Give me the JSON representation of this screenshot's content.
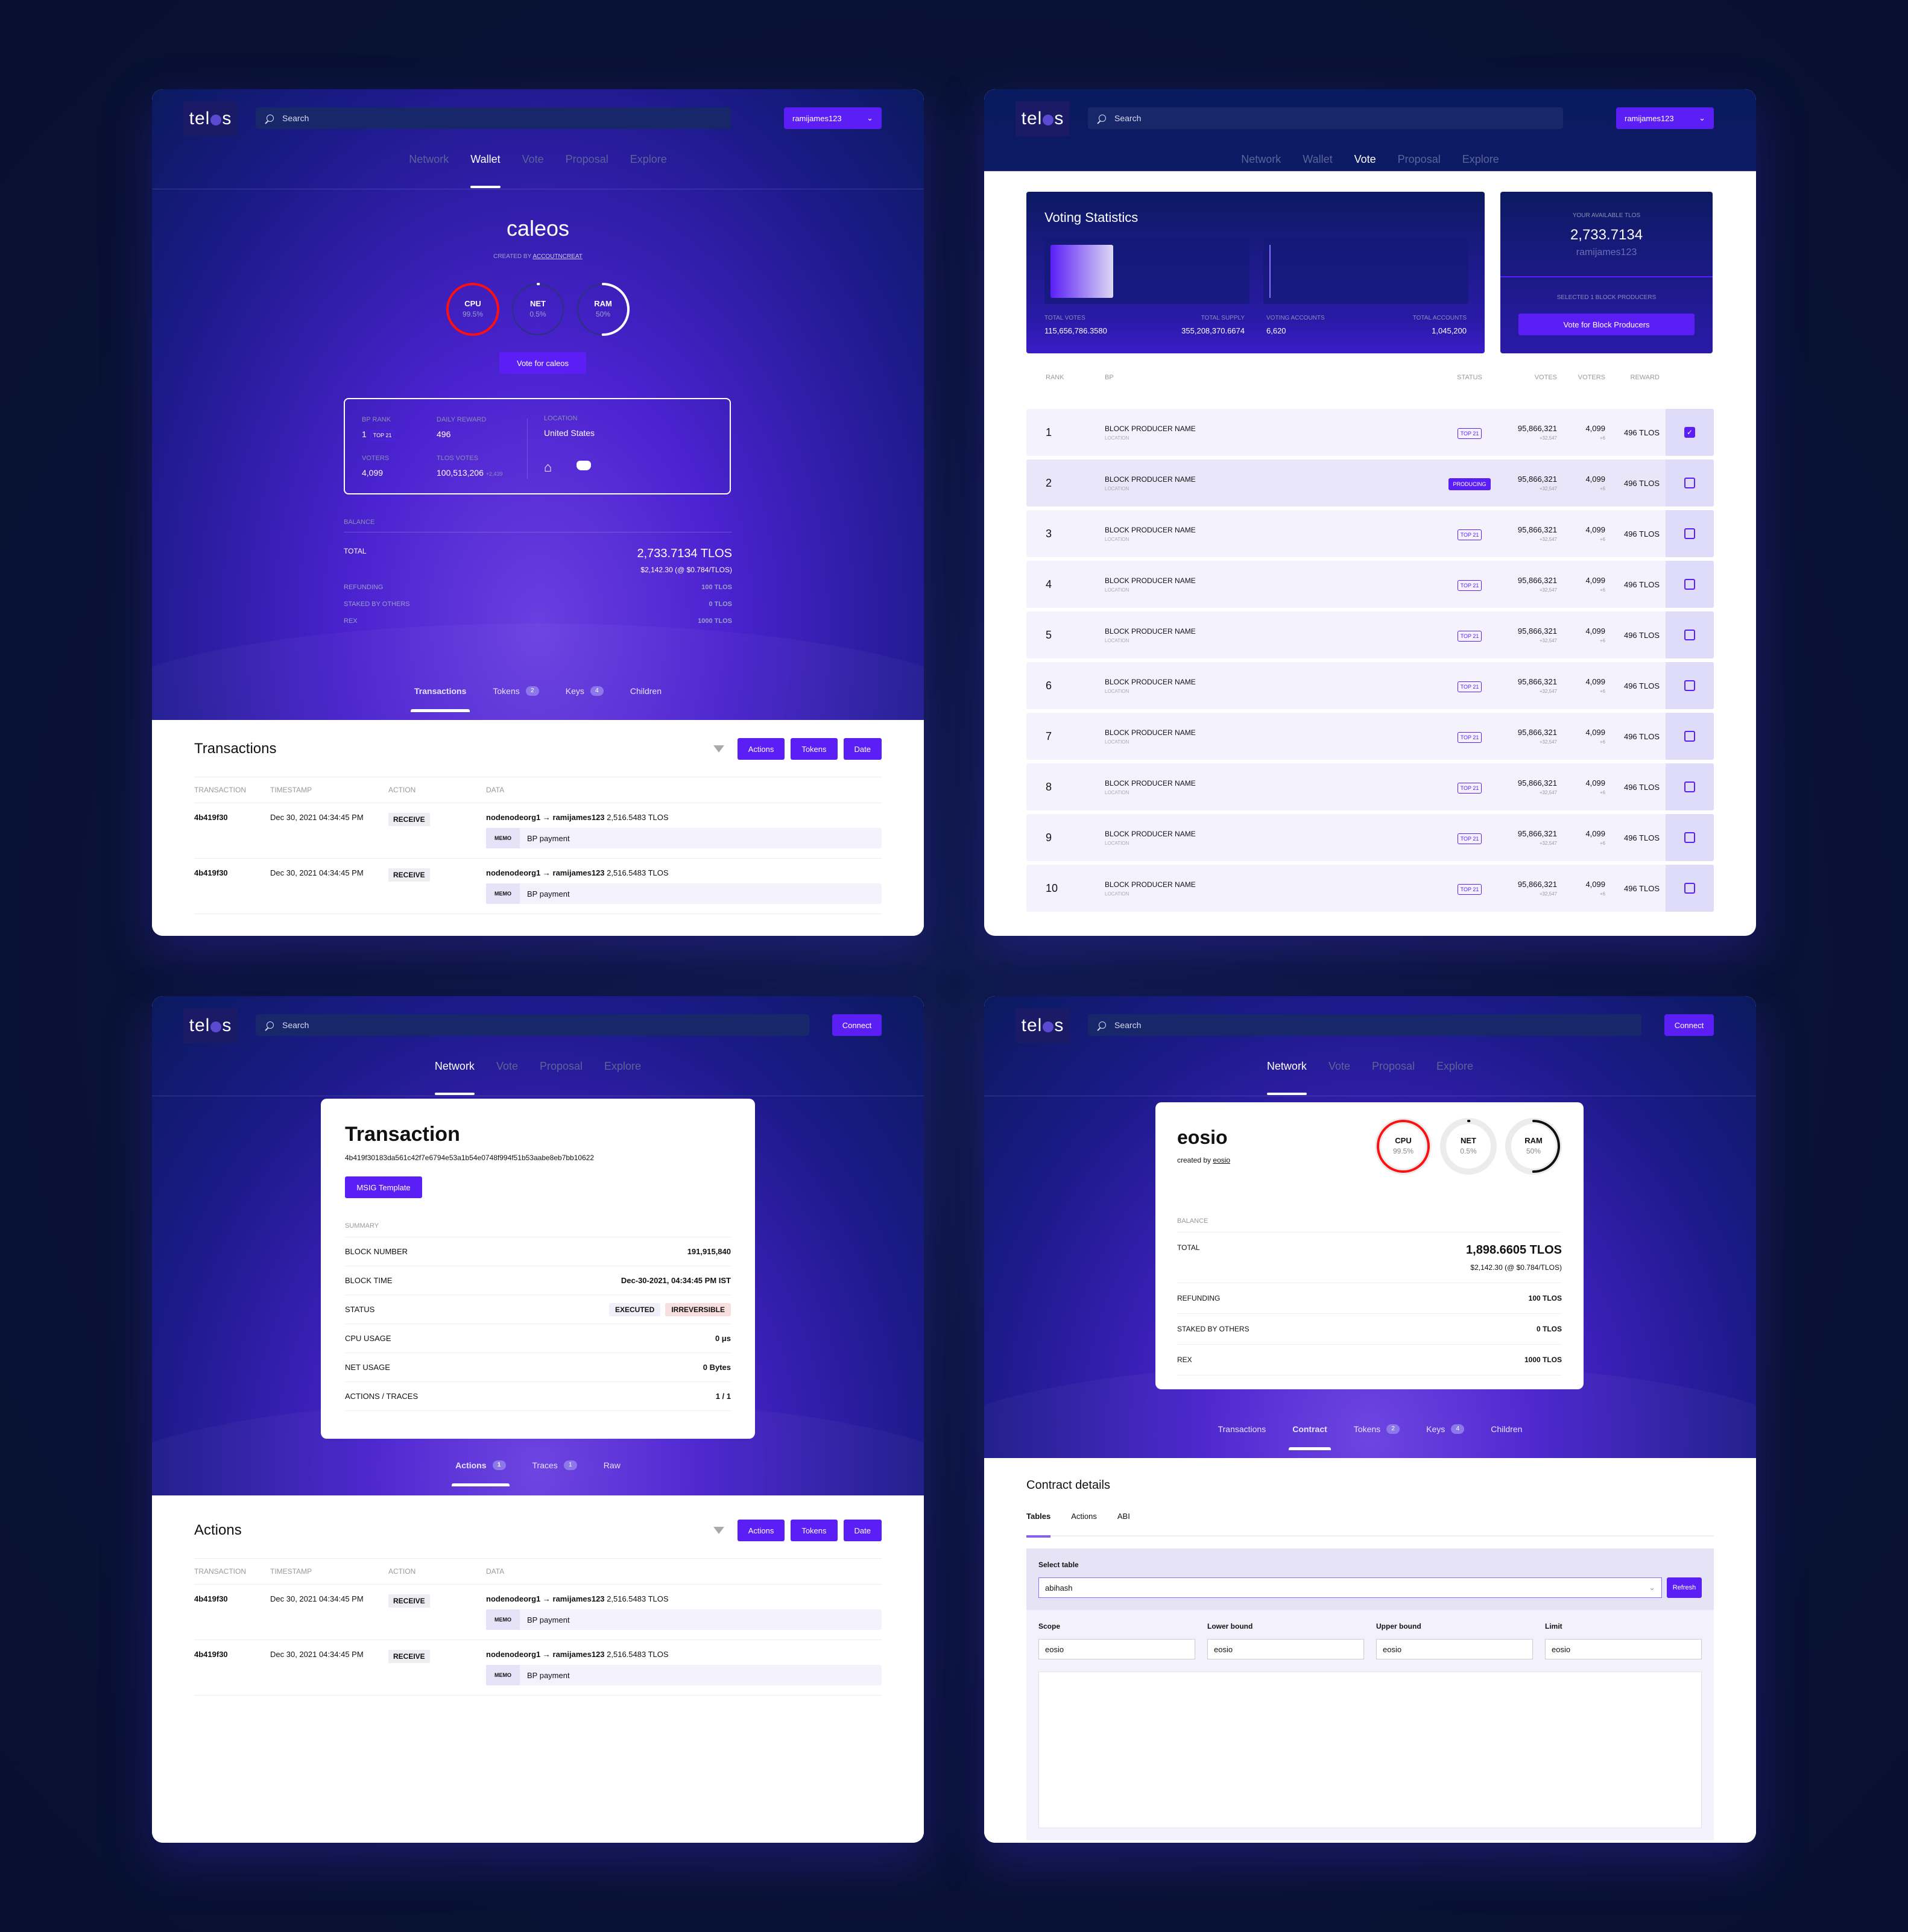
{
  "common": {
    "logo": "telos",
    "search_placeholder": "Search",
    "account": "ramijames123",
    "connect": "Connect"
  },
  "wallet": {
    "nav": [
      "Network",
      "Wallet",
      "Vote",
      "Proposal",
      "Explore"
    ],
    "nav_active": "Wallet",
    "account_name": "caleos",
    "created_by_label": "CREATED BY",
    "created_by": "ACCOUTNCREAT",
    "gauges": [
      {
        "label": "CPU",
        "value": "99.5%",
        "fraction": 0.995,
        "color": "#ff1010"
      },
      {
        "label": "NET",
        "value": "0.5%",
        "fraction": 0.005,
        "color": "#ffffff"
      },
      {
        "label": "RAM",
        "value": "50%",
        "fraction": 0.5,
        "color": "#ffffff"
      }
    ],
    "vote_button": "Vote for caleos",
    "bp": {
      "rank_label": "BP RANK",
      "rank": "1",
      "rank_badge": "TOP 21",
      "reward_label": "DAILY REWARD",
      "reward": "496",
      "voters_label": "VOTERS",
      "voters": "4,099",
      "votes_label": "TLOS VOTES",
      "votes": "100,513,206",
      "votes_delta": "+2,439",
      "location_label": "LOCATION",
      "location": "United States"
    },
    "balance": {
      "label": "BALANCE",
      "total_label": "TOTAL",
      "total": "2,733.7134 TLOS",
      "usd": "$2,142.30 (@ $0.784/TLOS)",
      "rows": [
        {
          "label": "REFUNDING",
          "value": "100 TLOS"
        },
        {
          "label": "STAKED BY OTHERS",
          "value": "0 TLOS"
        },
        {
          "label": "REX",
          "value": "1000 TLOS"
        }
      ]
    },
    "tabs": [
      {
        "label": "Transactions",
        "badge": null,
        "active": true
      },
      {
        "label": "Tokens",
        "badge": "2"
      },
      {
        "label": "Keys",
        "badge": "4"
      },
      {
        "label": "Children",
        "badge": null
      }
    ],
    "section_title": "Transactions",
    "filters": [
      "Actions",
      "Tokens",
      "Date"
    ],
    "columns": [
      "TRANSACTION",
      "TIMESTAMP",
      "ACTION",
      "DATA"
    ],
    "rows": [
      {
        "tx": "4b419f30",
        "time": "Dec 30, 2021 04:34:45 PM",
        "action": "RECEIVE",
        "from": "nodenodeorg1",
        "to": "ramijames123",
        "amount": "2,516.5483 TLOS",
        "memo_label": "MEMO",
        "memo": "BP payment"
      },
      {
        "tx": "4b419f30",
        "time": "Dec 30, 2021 04:34:45 PM",
        "action": "RECEIVE",
        "from": "nodenodeorg1",
        "to": "ramijames123",
        "amount": "2,516.5483 TLOS",
        "memo_label": "MEMO",
        "memo": "BP payment"
      }
    ]
  },
  "vote": {
    "nav": [
      "Network",
      "Wallet",
      "Vote",
      "Proposal",
      "Explore"
    ],
    "nav_active": "Vote",
    "stats_title": "Voting Statistics",
    "votes_fraction": 0.326,
    "accounts_fraction": 0.006,
    "stats": [
      {
        "label": "TOTAL VOTES",
        "value": "115,656,786.3580"
      },
      {
        "label": "TOTAL SUPPLY",
        "value": "355,208,370.6674"
      },
      {
        "label": "VOTING ACCOUNTS",
        "value": "6,620"
      },
      {
        "label": "TOTAL ACCOUNTS",
        "value": "1,045,200"
      }
    ],
    "available_label": "YOUR AVAILABLE TLOS",
    "available": "2,733.7134",
    "available_account": "ramijames123",
    "selected_label": "SELECTED 1 BLOCK PRODUCERS",
    "vote_button": "Vote for Block Producers",
    "columns": [
      "RANK",
      "BP",
      "STATUS",
      "VOTES",
      "VOTERS",
      "REWARD"
    ],
    "producers": [
      {
        "rank": "1",
        "name": "BLOCK PRODUCER NAME",
        "location": "LOCATION",
        "status": "TOP 21",
        "votes": "95,866,321",
        "votes_delta": "+32,547",
        "voters": "4,099",
        "voters_delta": "+6",
        "reward": "496 TLOS",
        "selected": true
      },
      {
        "rank": "2",
        "name": "BLOCK PRODUCER NAME",
        "location": "LOCATION",
        "status": "PRODUCING",
        "votes": "95,866,321",
        "votes_delta": "+32,547",
        "voters": "4,099",
        "voters_delta": "+6",
        "reward": "496 TLOS",
        "selected": false
      },
      {
        "rank": "3",
        "name": "BLOCK PRODUCER NAME",
        "location": "LOCATION",
        "status": "TOP 21",
        "votes": "95,866,321",
        "votes_delta": "+32,547",
        "voters": "4,099",
        "voters_delta": "+6",
        "reward": "496 TLOS",
        "selected": false
      },
      {
        "rank": "4",
        "name": "BLOCK PRODUCER NAME",
        "location": "LOCATION",
        "status": "TOP 21",
        "votes": "95,866,321",
        "votes_delta": "+32,547",
        "voters": "4,099",
        "voters_delta": "+6",
        "reward": "496 TLOS",
        "selected": false
      },
      {
        "rank": "5",
        "name": "BLOCK PRODUCER NAME",
        "location": "LOCATION",
        "status": "TOP 21",
        "votes": "95,866,321",
        "votes_delta": "+32,547",
        "voters": "4,099",
        "voters_delta": "+6",
        "reward": "496 TLOS",
        "selected": false
      },
      {
        "rank": "6",
        "name": "BLOCK PRODUCER NAME",
        "location": "LOCATION",
        "status": "TOP 21",
        "votes": "95,866,321",
        "votes_delta": "+32,547",
        "voters": "4,099",
        "voters_delta": "+6",
        "reward": "496 TLOS",
        "selected": false
      },
      {
        "rank": "7",
        "name": "BLOCK PRODUCER NAME",
        "location": "LOCATION",
        "status": "TOP 21",
        "votes": "95,866,321",
        "votes_delta": "+32,547",
        "voters": "4,099",
        "voters_delta": "+6",
        "reward": "496 TLOS",
        "selected": false
      },
      {
        "rank": "8",
        "name": "BLOCK PRODUCER NAME",
        "location": "LOCATION",
        "status": "TOP 21",
        "votes": "95,866,321",
        "votes_delta": "+32,547",
        "voters": "4,099",
        "voters_delta": "+6",
        "reward": "496 TLOS",
        "selected": false
      },
      {
        "rank": "9",
        "name": "BLOCK PRODUCER NAME",
        "location": "LOCATION",
        "status": "TOP 21",
        "votes": "95,866,321",
        "votes_delta": "+32,547",
        "voters": "4,099",
        "voters_delta": "+6",
        "reward": "496 TLOS",
        "selected": false
      },
      {
        "rank": "10",
        "name": "BLOCK PRODUCER NAME",
        "location": "LOCATION",
        "status": "TOP 21",
        "votes": "95,866,321",
        "votes_delta": "+32,547",
        "voters": "4,099",
        "voters_delta": "+6",
        "reward": "496 TLOS",
        "selected": false
      }
    ]
  },
  "transaction": {
    "nav": [
      "Network",
      "Vote",
      "Proposal",
      "Explore"
    ],
    "nav_active": "Network",
    "title": "Transaction",
    "hash": "4b419f30183da561c42f7e6794e53a1b54e0748f994f51b53aabe8eb7bb10622",
    "msig_button": "MSIG Template",
    "summary_label": "SUMMARY",
    "summary": [
      {
        "label": "BLOCK NUMBER",
        "value": "191,915,840"
      },
      {
        "label": "BLOCK TIME",
        "value": "Dec-30-2021, 04:34:45 PM IST"
      },
      {
        "label": "STATUS",
        "badges": [
          "EXECUTED",
          "IRREVERSIBLE"
        ]
      },
      {
        "label": "CPU USAGE",
        "value": "0 μs"
      },
      {
        "label": "NET USAGE",
        "value": "0 Bytes"
      },
      {
        "label": "ACTIONS / TRACES",
        "value": "1 / 1"
      }
    ],
    "tabs": [
      {
        "label": "Actions",
        "badge": "1",
        "active": true
      },
      {
        "label": "Traces",
        "badge": "1"
      },
      {
        "label": "Raw",
        "badge": null
      }
    ],
    "section_title": "Actions",
    "filters": [
      "Actions",
      "Tokens",
      "Date"
    ],
    "columns": [
      "TRANSACTION",
      "TIMESTAMP",
      "ACTION",
      "DATA"
    ],
    "rows": [
      {
        "tx": "4b419f30",
        "time": "Dec 30, 2021 04:34:45 PM",
        "action": "RECEIVE",
        "from": "nodenodeorg1",
        "to": "ramijames123",
        "amount": "2,516.5483 TLOS",
        "memo_label": "MEMO",
        "memo": "BP payment"
      },
      {
        "tx": "4b419f30",
        "time": "Dec 30, 2021 04:34:45 PM",
        "action": "RECEIVE",
        "from": "nodenodeorg1",
        "to": "ramijames123",
        "amount": "2,516.5483 TLOS",
        "memo_label": "MEMO",
        "memo": "BP payment"
      }
    ]
  },
  "contract": {
    "nav": [
      "Network",
      "Vote",
      "Proposal",
      "Explore"
    ],
    "nav_active": "Network",
    "account_name": "eosio",
    "created_by_label": "created by",
    "created_by": "eosio",
    "gauges": [
      {
        "label": "CPU",
        "value": "99.5%",
        "fraction": 0.995,
        "color": "#ff1010"
      },
      {
        "label": "NET",
        "value": "0.5%",
        "fraction": 0.005,
        "color": "#111111"
      },
      {
        "label": "RAM",
        "value": "50%",
        "fraction": 0.5,
        "color": "#111111"
      }
    ],
    "balance": {
      "label": "BALANCE",
      "total_label": "TOTAL",
      "total": "1,898.6605 TLOS",
      "usd": "$2,142.30 (@ $0.784/TLOS)",
      "rows": [
        {
          "label": "REFUNDING",
          "value": "100 TLOS"
        },
        {
          "label": "STAKED BY OTHERS",
          "value": "0 TLOS"
        },
        {
          "label": "REX",
          "value": "1000 TLOS"
        }
      ]
    },
    "tabs": [
      {
        "label": "Transactions",
        "badge": null
      },
      {
        "label": "Contract",
        "badge": null,
        "active": true
      },
      {
        "label": "Tokens",
        "badge": "2"
      },
      {
        "label": "Keys",
        "badge": "4"
      },
      {
        "label": "Children",
        "badge": null
      }
    ],
    "section_title": "Contract details",
    "detail_tabs": [
      "Tables",
      "Actions",
      "ABI"
    ],
    "detail_active": "Tables",
    "select_label": "Select table",
    "select_value": "abihash",
    "refresh": "Refresh",
    "fields": [
      {
        "label": "Scope",
        "value": "eosio"
      },
      {
        "label": "Lower bound",
        "value": "eosio"
      },
      {
        "label": "Upper bound",
        "value": "eosio"
      },
      {
        "label": "Limit",
        "value": "eosio"
      }
    ]
  }
}
